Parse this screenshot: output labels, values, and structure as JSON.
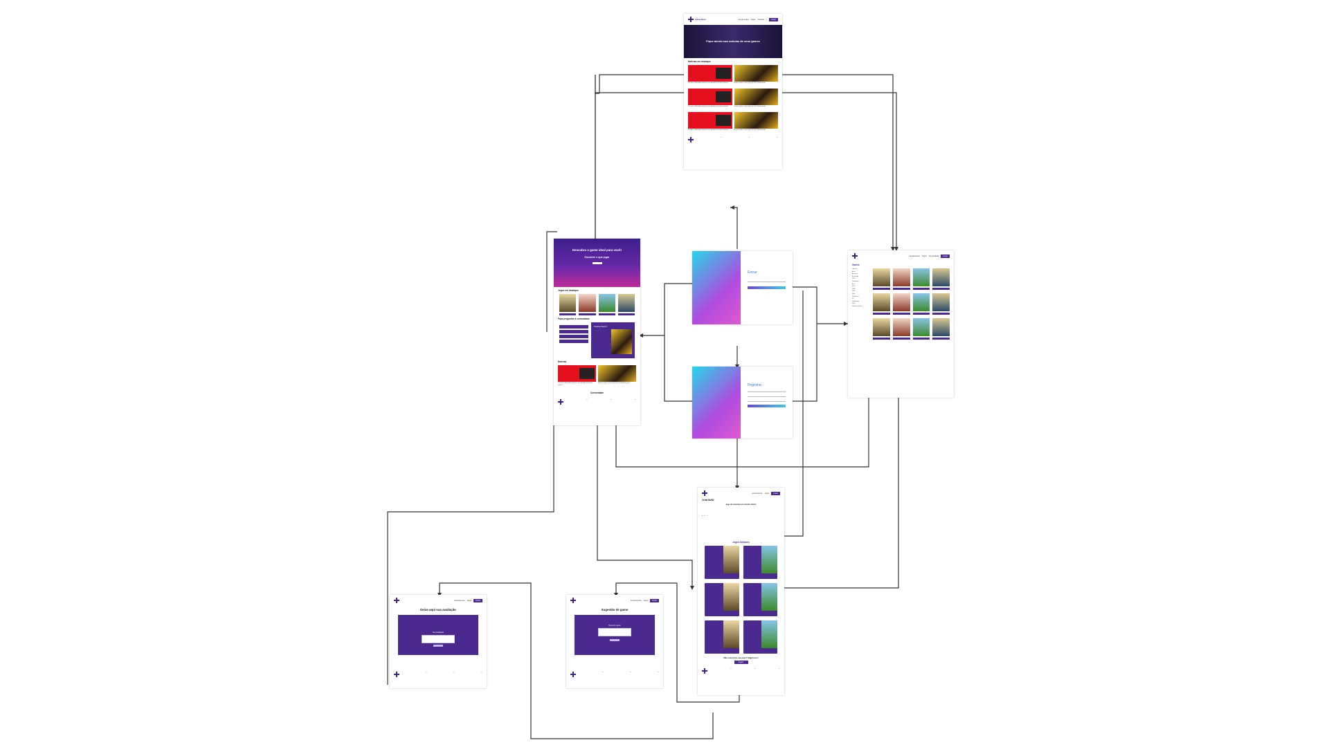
{
  "site": {
    "brand": "Game Next",
    "nav": [
      "Lançamentos",
      "Jogos",
      "Notícias",
      "Comunidade"
    ],
    "nav_button": "Entrar"
  },
  "home": {
    "hero_title": "Descubra o game ideal para você!",
    "hero_subtitle": "Encontre o que jogar",
    "games_section": "Jogos em destaque",
    "suggest_section": "Faça perguntas à comunidade",
    "news_section": "Notícias",
    "community_section": "Comunidade",
    "feature_card": "Scarlet Nexus"
  },
  "news_page": {
    "hero_title": "Fique atento nas notícias de seus games",
    "section_title": "Notícias em destaque",
    "items": [
      "Por que a Nintendo colocou suas dúvidas em maior número",
      "Notícia sobre o novo jogo da série Borderlands",
      "Por que a Nintendo colocou suas dúvidas em maior número",
      "Notícia sobre o novo jogo da série Borderlands",
      "Por que a Nintendo colocou suas dúvidas em maior número",
      "Notícia sobre o novo jogo da série Borderlands"
    ],
    "thumb_label": "2 SWITCH"
  },
  "login": {
    "title": "Entrar",
    "button": "Entrar"
  },
  "register": {
    "title": "Registrar",
    "button": "Cadastrar"
  },
  "games_page": {
    "title": "Games",
    "filters": [
      "Gênero",
      "Ação",
      "Aventura",
      "Estratégia",
      "RPG",
      "Plataforma",
      "Ano",
      "2022",
      "2021",
      "2020",
      "Nota",
      "Plataforma",
      "PC",
      "PlayStation",
      "Xbox",
      "Nintendo Switch"
    ]
  },
  "detail_page": {
    "title": "Zelda BotW",
    "question": "Jogo de aventura em mundo aberto",
    "related_section": "Jogos Similares",
    "cta_text": "Não encontrou seu jogo? Sugira-nos!",
    "cta_button": "Sugerir"
  },
  "review_page": {
    "title": "Deixe aqui sua avaliação",
    "field_label": "Sua avaliação",
    "button": "Enviar"
  },
  "suggest_page": {
    "title": "Sugestão de game",
    "field_label": "Nome do game",
    "button": "Enviar"
  },
  "colors": {
    "brand_purple": "#4b2a8f",
    "accent_red": "#e4101d",
    "connector": "#333333"
  }
}
